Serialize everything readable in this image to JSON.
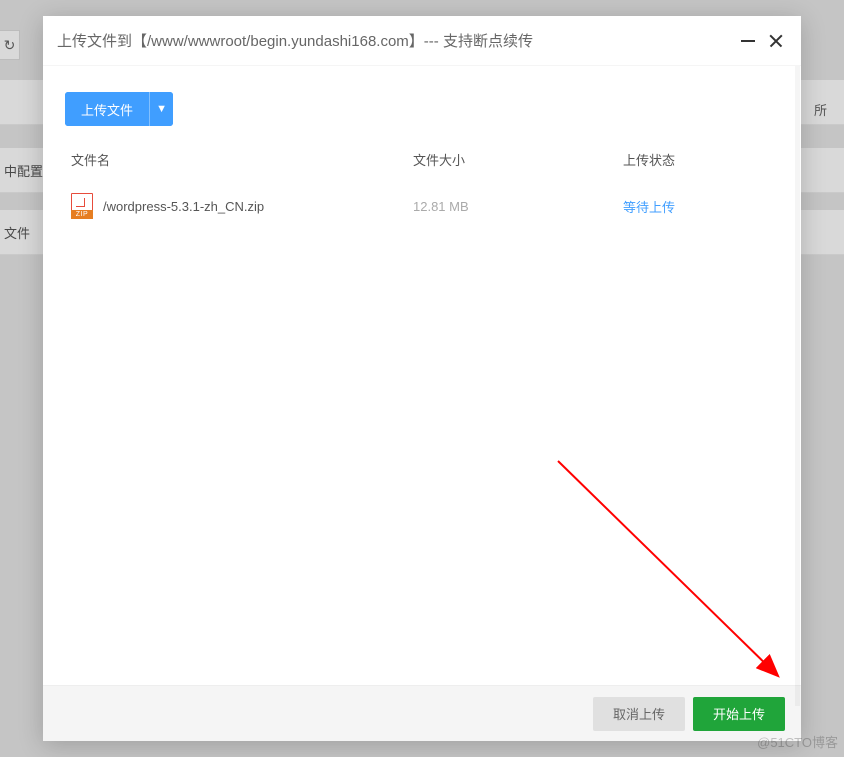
{
  "modal": {
    "title": "上传文件到【/www/wwwroot/begin.yundashi168.com】--- 支持断点续传",
    "upload_button": "上传文件",
    "dropdown_arrow": "▼"
  },
  "table": {
    "headers": {
      "name": "文件名",
      "size": "文件大小",
      "status": "上传状态"
    },
    "rows": [
      {
        "icon_type": "zip",
        "icon_tag": "ZIP",
        "name": "/wordpress-5.3.1-zh_CN.zip",
        "size": "12.81 MB",
        "status": "等待上传"
      }
    ]
  },
  "footer": {
    "cancel": "取消上传",
    "start": "开始上传"
  },
  "background": {
    "refresh": "↻",
    "row1": "",
    "row2": "中配置",
    "row3": "文件",
    "right_header": "所"
  },
  "watermark": "@51CTO博客"
}
